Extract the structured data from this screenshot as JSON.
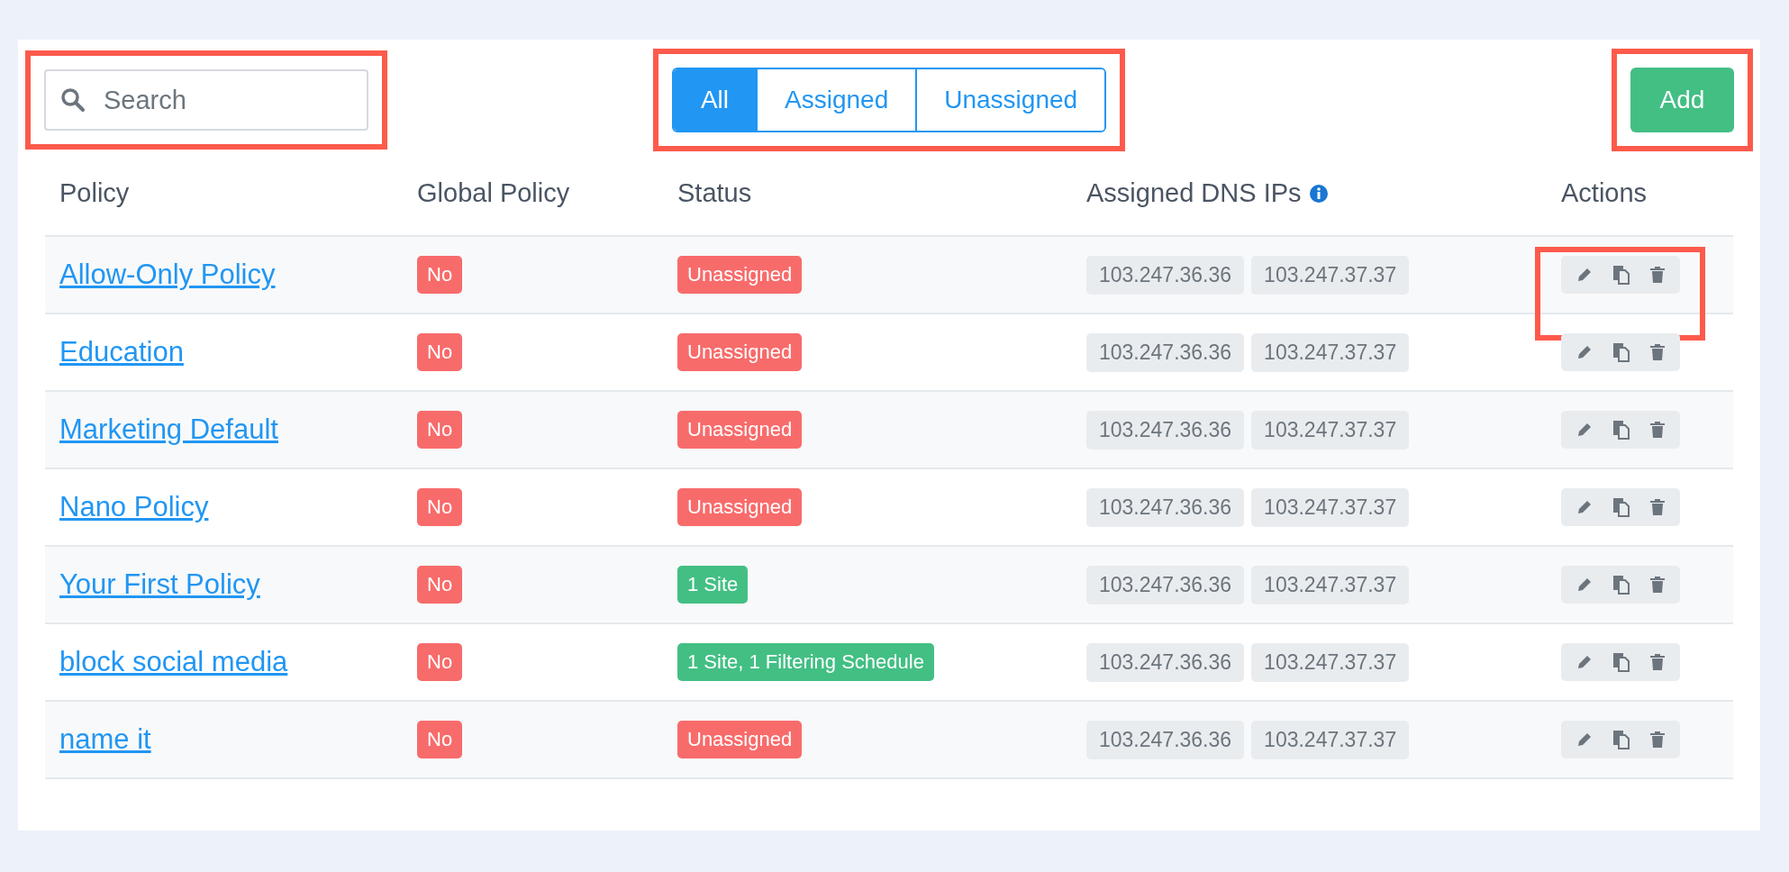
{
  "search": {
    "placeholder": "Search",
    "highlighted": true
  },
  "filters": {
    "highlighted": true,
    "items": [
      {
        "label": "All",
        "selected": true
      },
      {
        "label": "Assigned",
        "selected": false
      },
      {
        "label": "Unassigned",
        "selected": false
      }
    ]
  },
  "add_button": {
    "label": "Add",
    "highlighted": true
  },
  "table": {
    "columns": [
      "Policy",
      "Global Policy",
      "Status",
      "Assigned DNS IPs",
      "Actions"
    ],
    "rows": [
      {
        "policy": "Allow-Only Policy",
        "global": "No",
        "status": {
          "label": "Unassigned",
          "color": "#f86b6b"
        },
        "ips": [
          "103.247.36.36",
          "103.247.37.37"
        ],
        "actions_highlighted": true
      },
      {
        "policy": "Education",
        "global": "No",
        "status": {
          "label": "Unassigned",
          "color": "#f86b6b"
        },
        "ips": [
          "103.247.36.36",
          "103.247.37.37"
        ],
        "actions_highlighted": false
      },
      {
        "policy": "Marketing Default",
        "global": "No",
        "status": {
          "label": "Unassigned",
          "color": "#f86b6b"
        },
        "ips": [
          "103.247.36.36",
          "103.247.37.37"
        ],
        "actions_highlighted": false
      },
      {
        "policy": "Nano Policy",
        "global": "No",
        "status": {
          "label": "Unassigned",
          "color": "#f86b6b"
        },
        "ips": [
          "103.247.36.36",
          "103.247.37.37"
        ],
        "actions_highlighted": false
      },
      {
        "policy": "Your First Policy",
        "global": "No",
        "status": {
          "label": "1 Site",
          "color": "#43bf84"
        },
        "ips": [
          "103.247.36.36",
          "103.247.37.37"
        ],
        "actions_highlighted": false
      },
      {
        "policy": "block social media",
        "global": "No",
        "status": {
          "label": "1 Site, 1 Filtering Schedule",
          "color": "#43bf84"
        },
        "ips": [
          "103.247.36.36",
          "103.247.37.37"
        ],
        "actions_highlighted": false
      },
      {
        "policy": "name it",
        "global": "No",
        "status": {
          "label": "Unassigned",
          "color": "#f86b6b"
        },
        "ips": [
          "103.247.36.36",
          "103.247.37.37"
        ],
        "actions_highlighted": false
      }
    ]
  }
}
